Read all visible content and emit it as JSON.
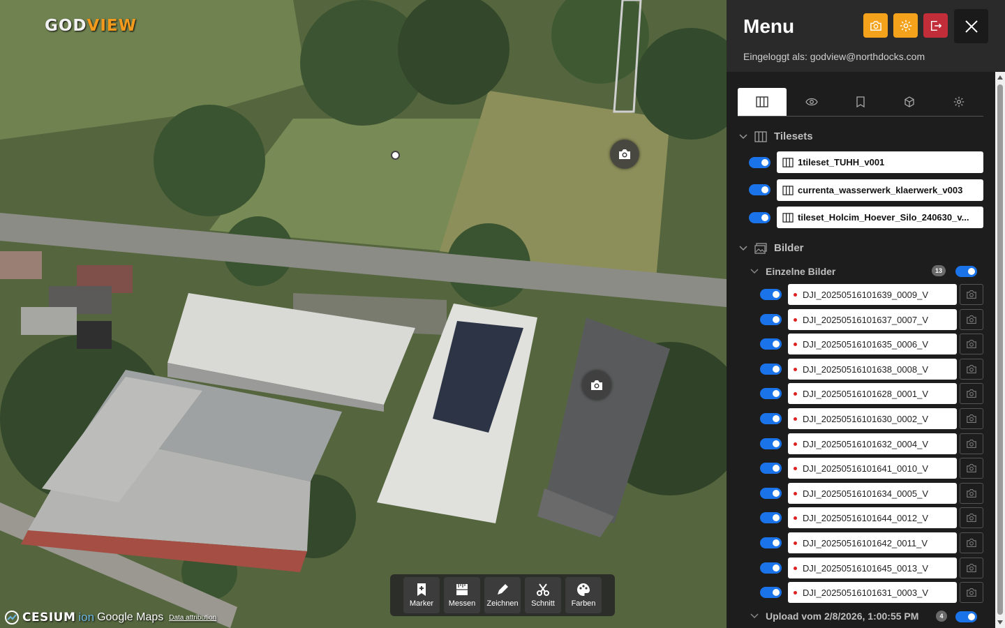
{
  "map": {
    "logo_main": "GOD",
    "logo_accent": "VIEW",
    "attribution": {
      "cesium": "CESIUM",
      "ion": "ion",
      "google": "Google Maps",
      "data": "Data attribution"
    }
  },
  "toolbar": {
    "items": [
      {
        "label": "Marker",
        "icon": "bookmark-plus-icon"
      },
      {
        "label": "Messen",
        "icon": "ruler-icon"
      },
      {
        "label": "Zeichnen",
        "icon": "pencil-icon"
      },
      {
        "label": "Schnitt",
        "icon": "scissors-icon"
      },
      {
        "label": "Farben",
        "icon": "palette-icon"
      }
    ]
  },
  "panel": {
    "title": "Menu",
    "logged_in": "Eingeloggt als: godview@northdocks.com",
    "tabs": [
      "layers-icon",
      "eye-icon",
      "bookmark-icon",
      "cube-icon",
      "gear-icon"
    ],
    "tilesets": {
      "title": "Tilesets",
      "items": [
        {
          "name": "1tileset_TUHH_v001"
        },
        {
          "name": "currenta_wasserwerk_klaerwerk_v003"
        },
        {
          "name": "tileset_Holcim_Hoever_Silo_240630_v..."
        }
      ]
    },
    "bilder": {
      "title": "Bilder",
      "single": {
        "title": "Einzelne Bilder",
        "count": "13",
        "items": [
          "DJI_20250516101639_0009_V",
          "DJI_20250516101637_0007_V",
          "DJI_20250516101635_0006_V",
          "DJI_20250516101638_0008_V",
          "DJI_20250516101628_0001_V",
          "DJI_20250516101630_0002_V",
          "DJI_20250516101632_0004_V",
          "DJI_20250516101641_0010_V",
          "DJI_20250516101634_0005_V",
          "DJI_20250516101644_0012_V",
          "DJI_20250516101642_0011_V",
          "DJI_20250516101645_0013_V",
          "DJI_20250516101631_0003_V"
        ]
      },
      "upload": {
        "title": "Upload vom 2/8/2026, 1:00:55 PM",
        "count": "4"
      }
    },
    "colors": {
      "accent": "#f4a21c",
      "logout": "#c12d39",
      "toggle": "#1a73e8"
    }
  }
}
